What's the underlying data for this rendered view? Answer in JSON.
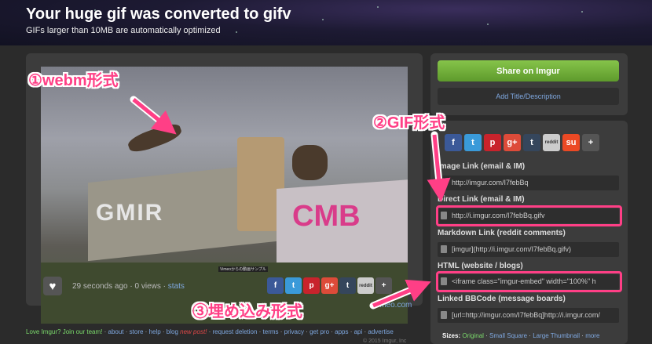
{
  "header": {
    "title": "Your huge gif was converted to gifv",
    "subtitle": "GIFs larger than 10MB are automatically optimized"
  },
  "media": {
    "caption": "Vimeoからの動画サンプル",
    "stats_time": "29 seconds ago",
    "stats_views": "0 views",
    "stats_link": "stats",
    "source": "vimeo.com"
  },
  "share": {
    "button": "Share on Imgur",
    "add_title": "Add Title/Description"
  },
  "social_icons": [
    "f",
    "t",
    "p",
    "g+",
    "t",
    "reddit",
    "su",
    "+"
  ],
  "links": [
    {
      "label": "Image Link (email & IM)",
      "value": "http://imgur.com/I7febBq"
    },
    {
      "label": "Direct Link (email & IM)",
      "value": "http://i.imgur.com/I7febBq.gifv"
    },
    {
      "label": "Markdown Link (reddit comments)",
      "value": "[imgur](http://i.imgur.com/I7febBq.gifv)"
    },
    {
      "label": "HTML (website / blogs)",
      "value": "<iframe class=\"imgur-embed\" width=\"100%\" h"
    },
    {
      "label": "Linked BBCode (message boards)",
      "value": "[url=http://imgur.com/I7febBq]http://i.imgur.com/"
    }
  ],
  "sizes": {
    "label": "Sizes:",
    "options": [
      "Original",
      "Small Square",
      "Large Thumbnail",
      "more"
    ]
  },
  "footer": {
    "love": "Love Imgur? Join our team!",
    "links": [
      "about",
      "store",
      "help",
      "blog",
      "new post!",
      "request deletion",
      "terms",
      "privacy",
      "get pro",
      "apps",
      "api",
      "advertise"
    ],
    "copyright": "© 2015 Imgur, Inc"
  },
  "annotations": {
    "webm": "①webm形式",
    "gif": "②GIF形式",
    "embed": "③埋め込み形式"
  },
  "colors": {
    "highlight": "#ff3f86",
    "share_green": "#6fb03a",
    "link_blue": "#7fa8e0"
  }
}
